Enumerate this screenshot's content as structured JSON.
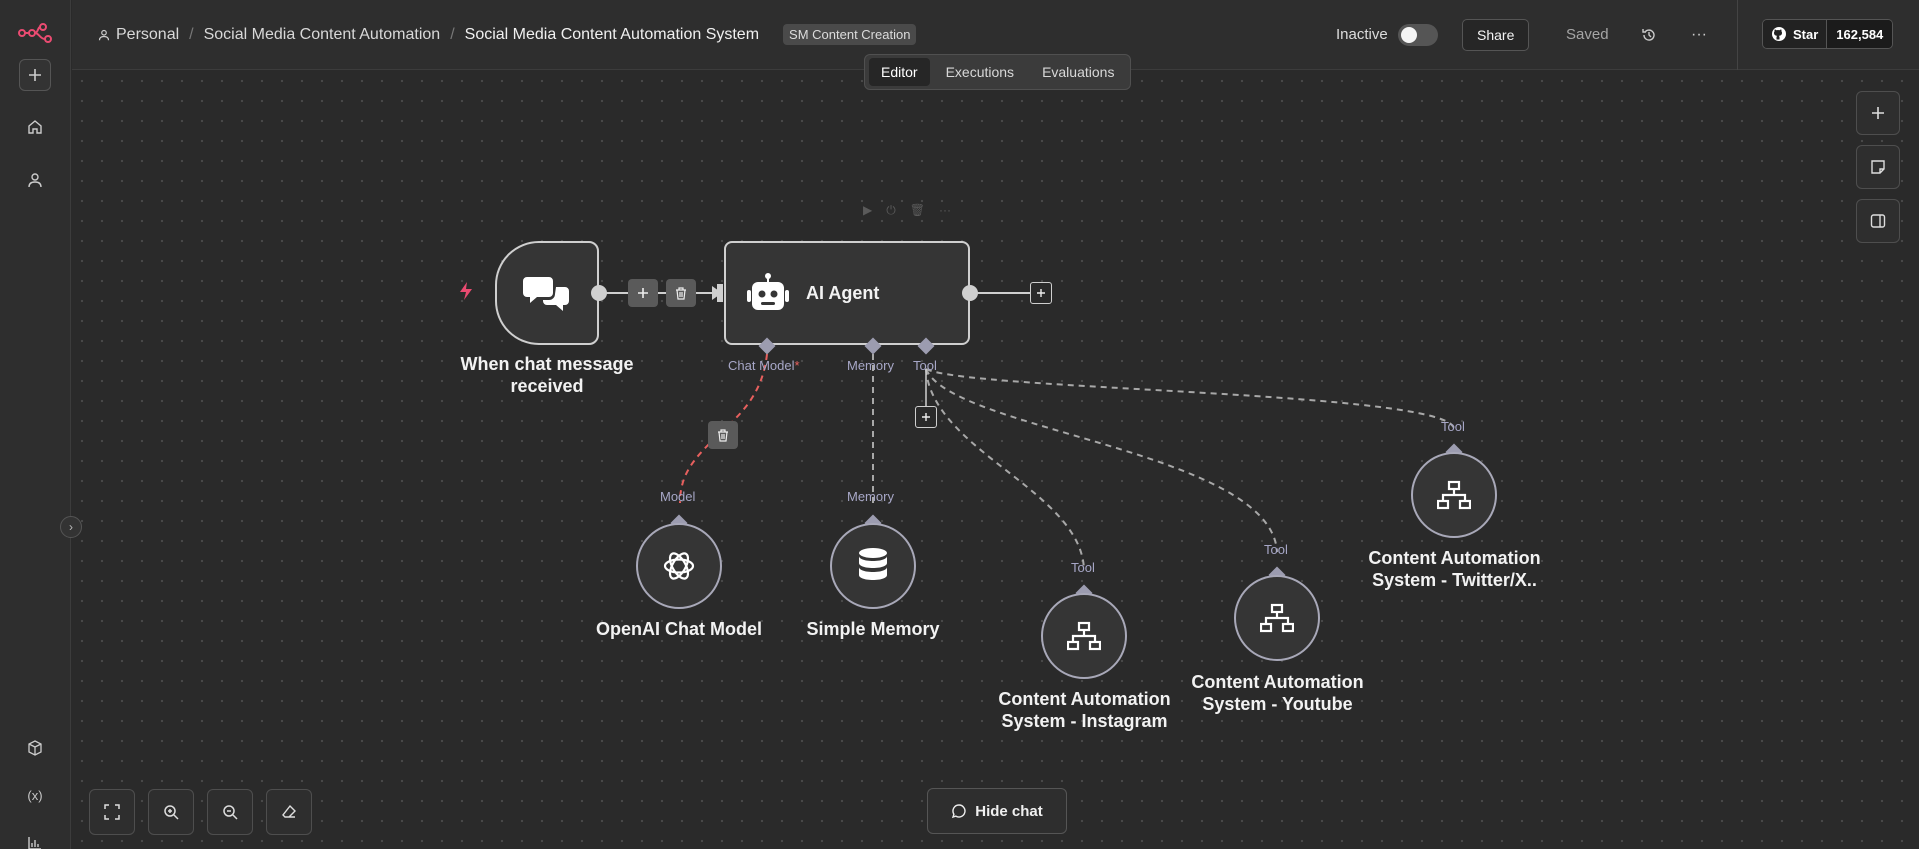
{
  "breadcrumb": {
    "personal": "Personal",
    "project": "Social Media Content Automation",
    "workflow": "Social Media Content Automation System",
    "tag": "SM Content Creation"
  },
  "tabs": {
    "editor": "Editor",
    "executions": "Executions",
    "evaluations": "Evaluations"
  },
  "header": {
    "status": "Inactive",
    "share": "Share",
    "saved": "Saved",
    "github_star": "Star",
    "github_count": "162,584"
  },
  "nodes": {
    "chat_trigger": {
      "line1": "When chat message",
      "line2": "received"
    },
    "agent": {
      "label": "AI Agent"
    },
    "openai": {
      "label": "OpenAI Chat Model"
    },
    "memory": {
      "label": "Simple Memory"
    },
    "instagram": {
      "line1": "Content Automation",
      "line2": "System - Instagram"
    },
    "youtube": {
      "line1": "Content Automation",
      "line2": "System - Youtube"
    },
    "twitter": {
      "line1": "Content Automation",
      "line2": "System - Twitter/X.."
    }
  },
  "ports": {
    "chat_model": "Chat Model",
    "required_mark": "*",
    "memory": "Memory",
    "tool": "Tool",
    "model": "Model"
  },
  "canvas": {
    "hide_chat": "Hide chat"
  },
  "colors": {
    "accent": "#ea4b71",
    "canvas_bg": "#2a2a2a",
    "node_border": "#cfcfcf",
    "port_label": "#a7a7c7",
    "danger_edge": "#e8605e"
  },
  "icons": [
    "n8n-logo-icon",
    "plus-icon",
    "home-icon",
    "user-icon",
    "cube-icon",
    "variables-icon",
    "chart-icon",
    "history-icon",
    "more-icon",
    "github-icon",
    "chat-icon",
    "robot-icon",
    "openai-icon",
    "database-icon",
    "sitemap-icon",
    "zoom-in-icon",
    "zoom-out-icon",
    "fit-view-icon",
    "eraser-icon",
    "sticky-note-icon",
    "panel-icon",
    "trash-icon",
    "lightning-icon"
  ]
}
